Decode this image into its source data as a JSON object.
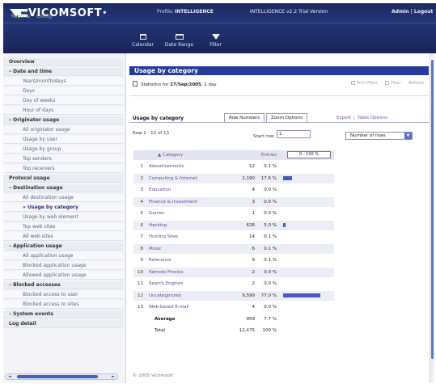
{
  "app": {
    "brand": "VICOMSOFT",
    "profile_label": "Profile:",
    "profile_value": "INTELLIGENCE",
    "version": "INTELLIGENCE v2.2 Trial Version",
    "admin_logout": "Admin | Logout",
    "subnav": [
      "Reports",
      "Config"
    ]
  },
  "toolbar": [
    {
      "label": "Calendar",
      "icon": "calendar-icon"
    },
    {
      "label": "Date Range",
      "icon": "date-range-icon"
    },
    {
      "label": "Filter",
      "icon": "filter-icon"
    }
  ],
  "sidebar": {
    "items": [
      {
        "label": "Overview",
        "type": "head"
      },
      {
        "label": "– Date and time",
        "type": "head"
      },
      {
        "label": "Years/month/days",
        "type": "sub"
      },
      {
        "label": "Days",
        "type": "sub"
      },
      {
        "label": "Day of weeks",
        "type": "sub"
      },
      {
        "label": "Hour of days",
        "type": "sub"
      },
      {
        "label": "– Originator usage",
        "type": "head"
      },
      {
        "label": "All originator usage",
        "type": "sub"
      },
      {
        "label": "Usage by user",
        "type": "sub"
      },
      {
        "label": "Usage by group",
        "type": "sub"
      },
      {
        "label": "Top senders",
        "type": "sub"
      },
      {
        "label": "Top receivers",
        "type": "sub"
      },
      {
        "label": "Protocol usage",
        "type": "head"
      },
      {
        "label": "– Destination usage",
        "type": "head"
      },
      {
        "label": "All destination usage",
        "type": "sub"
      },
      {
        "label": "» Usage by category",
        "type": "sub active"
      },
      {
        "label": "Usage by web element",
        "type": "sub"
      },
      {
        "label": "Top web sites",
        "type": "sub"
      },
      {
        "label": "All web sites",
        "type": "sub"
      },
      {
        "label": "– Application usage",
        "type": "head"
      },
      {
        "label": "All application usage",
        "type": "sub"
      },
      {
        "label": "Blocked application usage",
        "type": "sub"
      },
      {
        "label": "Allowed application usage",
        "type": "sub"
      },
      {
        "label": "– Blocked accesses",
        "type": "head"
      },
      {
        "label": "Blocked access to user",
        "type": "sub"
      },
      {
        "label": "Blocked access to sites",
        "type": "sub"
      },
      {
        "label": "– System events",
        "type": "head"
      },
      {
        "label": "Log detail",
        "type": "head"
      }
    ]
  },
  "main": {
    "title": "Usage by category",
    "stats_prefix": "Statistics for",
    "stats_date": "27/Sep/2005",
    "stats_suffix": ", 1 day",
    "actions": [
      "Print Filter",
      "Filter",
      "Refresh"
    ],
    "section_label": "Usage by category",
    "tabs": [
      "Row Numbers",
      "Zoom Options"
    ],
    "links": [
      "Export",
      "Table Options"
    ],
    "rows_info": "Row 1 - 13 of 13",
    "start_row_label": "Start row:",
    "start_row_value": "1",
    "rows_select": "Number of rows",
    "table": {
      "col_category": "▲ Category",
      "col_entries": "Entries",
      "scale_label": "0 - 100 %",
      "rows": [
        {
          "n": "1",
          "category": "Advertisements",
          "entries": "12",
          "pct": "0.1 %",
          "value": 0.1
        },
        {
          "n": "2",
          "category": "Computing & Internet",
          "entries": "2,190",
          "pct": "17.6 %",
          "value": 17.6
        },
        {
          "n": "3",
          "category": "Education",
          "entries": "4",
          "pct": "0.0 %",
          "value": 0.0
        },
        {
          "n": "4",
          "category": "Finance & Investment",
          "entries": "3",
          "pct": "0.0 %",
          "value": 0.0
        },
        {
          "n": "5",
          "category": "Games",
          "entries": "1",
          "pct": "0.0 %",
          "value": 0.0
        },
        {
          "n": "6",
          "category": "Hacking",
          "entries": "626",
          "pct": "5.0 %",
          "value": 5.0
        },
        {
          "n": "7",
          "category": "Hosting Sites",
          "entries": "14",
          "pct": "0.1 %",
          "value": 0.1
        },
        {
          "n": "8",
          "category": "Music",
          "entries": "6",
          "pct": "0.1 %",
          "value": 0.1
        },
        {
          "n": "9",
          "category": "Reference",
          "entries": "9",
          "pct": "0.1 %",
          "value": 0.1
        },
        {
          "n": "10",
          "category": "Remote Proxies",
          "entries": "2",
          "pct": "0.0 %",
          "value": 0.0
        },
        {
          "n": "11",
          "category": "Search Engines",
          "entries": "2",
          "pct": "0.0 %",
          "value": 0.0
        },
        {
          "n": "12",
          "category": "Uncategorized",
          "entries": "9,599",
          "pct": "77.0 %",
          "value": 77.0
        },
        {
          "n": "13",
          "category": "Web-based E-mail",
          "entries": "4",
          "pct": "0.0 %",
          "value": 0.0
        }
      ],
      "average_label": "Average",
      "average_entries": "959",
      "average_pct": "7.7 %",
      "total_label": "Total",
      "total_entries": "12,475",
      "total_pct": "100 %"
    },
    "footer": "© 2005 Vicomsoft"
  },
  "colors": {
    "header_bg": "#1e2a62",
    "title_bar": "#253a9b",
    "bar": "#4a58c4",
    "link": "#6b3f9a"
  }
}
